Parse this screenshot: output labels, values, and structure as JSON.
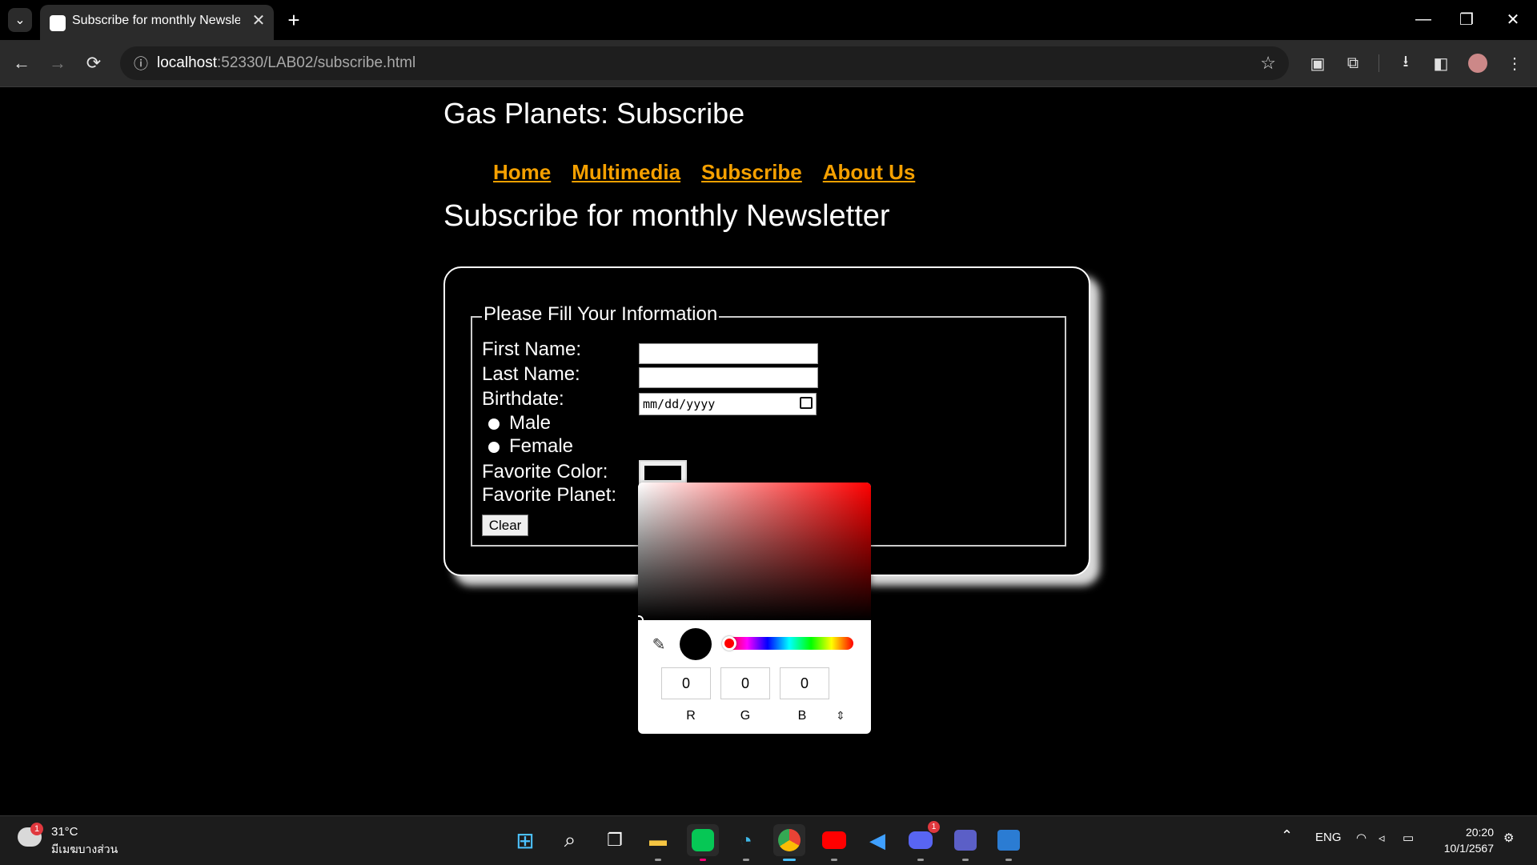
{
  "browser": {
    "tab_title": "Subscribe for monthly Newsletter",
    "tab_close": "✕",
    "new_tab": "+",
    "url_host": "localhost",
    "url_rest": ":52330/LAB02/subscribe.html",
    "back": "←",
    "forward": "→",
    "reload": "⟳",
    "star": "☆",
    "minimize": "—",
    "restore": "❐",
    "close": "✕"
  },
  "page": {
    "site_title": "Gas Planets: Subscribe",
    "nav": [
      "Home",
      "Multimedia",
      "Subscribe",
      "About Us"
    ],
    "heading": "Subscribe for monthly Newsletter"
  },
  "form": {
    "legend": "Please Fill Your Information",
    "first_name_label": "First Name:",
    "first_name_value": "",
    "last_name_label": "Last Name:",
    "last_name_value": "",
    "birthdate_label": "Birthdate:",
    "birthdate_placeholder": "mm/dd/yyyy",
    "gender_options": [
      "Male",
      "Female"
    ],
    "favorite_color_label": "Favorite Color:",
    "favorite_color_value": "#000000",
    "favorite_planet_label": "Favorite Planet:",
    "clear_button": "Clear"
  },
  "color_picker": {
    "r": "0",
    "g": "0",
    "b": "0",
    "labels": [
      "R",
      "G",
      "B"
    ],
    "hue_color": "#ff0000",
    "selected_color": "#000000"
  },
  "colors": {
    "nav_link": "#f5a000",
    "background": "#000000",
    "text": "#ffffff"
  },
  "taskbar": {
    "temperature": "31°C",
    "weather_desc": "มีเมฆบางส่วน",
    "weather_badge": "1",
    "discord_badge": "1",
    "lang": "ENG",
    "time": "20:20",
    "date": "10/1/2567",
    "apps": [
      "start-icon",
      "search-icon",
      "task-view-icon",
      "file-explorer-icon",
      "line-icon",
      "edge-icon",
      "chrome-icon",
      "youtube-icon",
      "vscode-icon",
      "discord-icon",
      "teams-icon",
      "word-icon"
    ]
  }
}
